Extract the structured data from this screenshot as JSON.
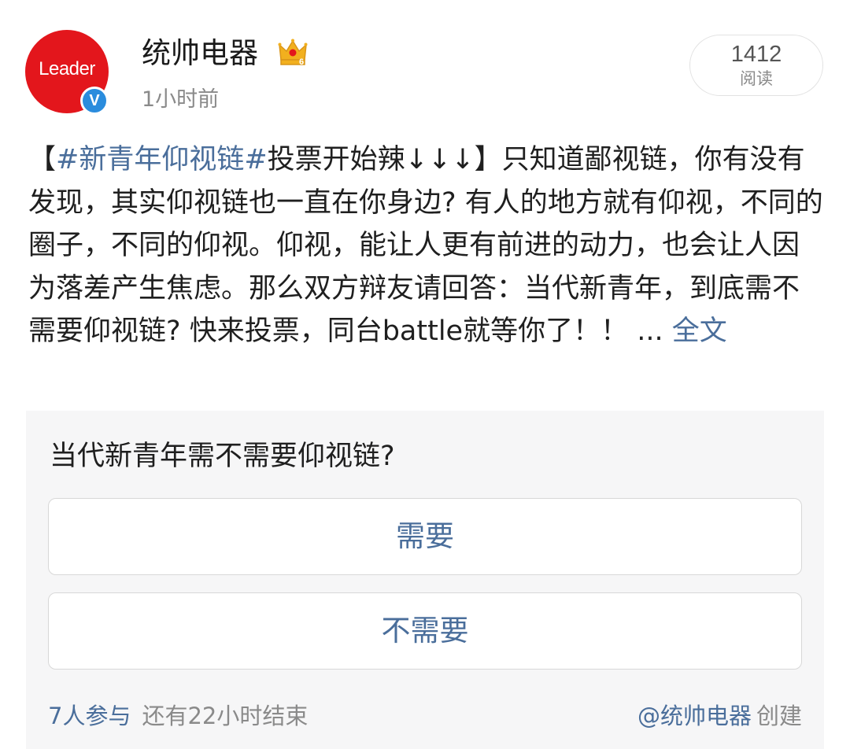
{
  "post": {
    "avatar_logo": "Leader",
    "verified_badge": "V",
    "author": "统帅电器",
    "badge_icon": "crown-level-icon",
    "badge_level": "6",
    "time": "1小时前",
    "read_count": "1412",
    "read_label": "阅读",
    "text": {
      "open_bracket": "【",
      "hashtag": "#新青年仰视链#",
      "lead": "投票开始辣↓↓↓】",
      "body": "只知道鄙视链，你有没有发现，其实仰视链也一直在你身边? 有人的地方就有仰视，不同的圈子，不同的仰视。仰视，能让人更有前进的动力，也会让人因为落差产生焦虑。那么双方辩友请回答：当代新青年，到底需不需要仰视链? 快来投票，同台battle就等你了！！",
      "ellipsis": " ... ",
      "more_link": "全文"
    }
  },
  "poll": {
    "question": "当代新青年需不需要仰视链?",
    "options": [
      "需要",
      "不需要"
    ],
    "participants": "7人参与",
    "remaining": "还有22小时结束",
    "creator": "@统帅电器",
    "created_label": "创建"
  },
  "colors": {
    "link": "#4a6e9b",
    "avatar_red": "#e3161c",
    "verified_blue": "#2a8cdd",
    "crown_gold": "#f2b01e",
    "poll_bg": "#f6f6f7"
  }
}
